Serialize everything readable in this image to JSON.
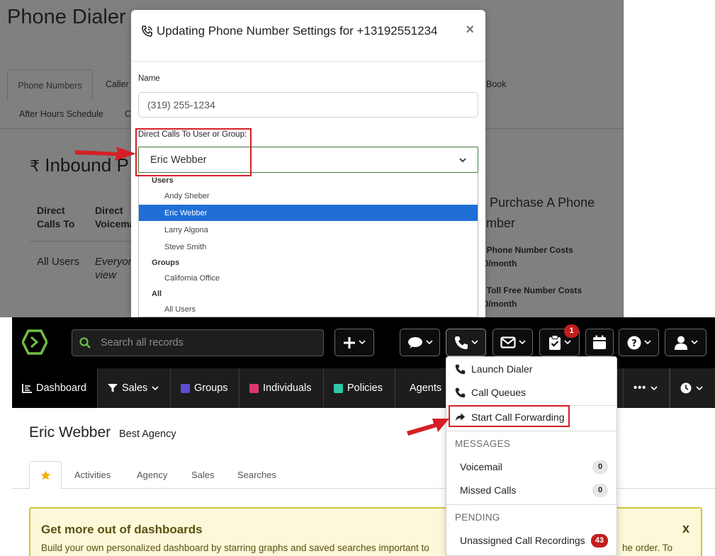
{
  "top_screenshot": {
    "page_title": "Phone Dialer",
    "page_tabs": [
      "Phone Numbers",
      "Caller I",
      "Book",
      "After Hours Schedule",
      "Cl"
    ],
    "section_title": "Inbound P",
    "table": {
      "headers": [
        "Direct Calls To",
        "Direct Voicema"
      ],
      "row": [
        "All Users",
        "Everyon view"
      ]
    },
    "side_panel": {
      "heading": "d Purchase A Phone umber",
      "line1": "h Phone Number Costs",
      "line1_price": "00/month",
      "line2": "h Toll Free Number Costs",
      "line2_price": "00/month"
    },
    "modal": {
      "title": "Updating Phone Number Settings for +13192551234",
      "close_label": "×",
      "name_label": "Name",
      "name_value": "(319) 255-1234",
      "direct_calls_label": "Direct Calls To User or Group:",
      "selected_value": "Eric Webber",
      "options": {
        "users_label": "Users",
        "users": [
          "Andy Sheber",
          "Eric Webber",
          "Larry Algona",
          "Steve Smith"
        ],
        "groups_label": "Groups",
        "groups": [
          "California Office"
        ],
        "all_label": "All",
        "all": [
          "All Users"
        ]
      }
    }
  },
  "bottom_screenshot": {
    "search_placeholder": "Search all records",
    "task_badge": "1",
    "nav": {
      "items": [
        "Dashboard",
        "Sales",
        "Groups",
        "Individuals",
        "Policies",
        "Agents"
      ],
      "colors": {
        "Groups": "#5b4fcf",
        "Individuals": "#e0356a",
        "Policies": "#2dc8a8",
        "Agents": "#2e8fe0"
      }
    },
    "contact": {
      "name": "Eric Webber",
      "agency": "Best Agency"
    },
    "sub_tabs": [
      "Activities",
      "Agency",
      "Sales",
      "Searches"
    ],
    "promo": {
      "title": "Get more out of dashboards",
      "text": "Build your own personalized dashboard by starring graphs and saved searches important to",
      "text_tail": "he order. To",
      "close": "x"
    },
    "phone_menu": {
      "launch_dialer": "Launch Dialer",
      "call_queues": "Call Queues",
      "start_call_forwarding": "Start Call Forwarding",
      "messages_header": "MESSAGES",
      "voicemail": "Voicemail",
      "voicemail_count": "0",
      "missed_calls": "Missed Calls",
      "missed_calls_count": "0",
      "pending_header": "PENDING",
      "unassigned": "Unassigned Call Recordings",
      "unassigned_count": "43"
    }
  },
  "annotation_color": "#d41f26"
}
